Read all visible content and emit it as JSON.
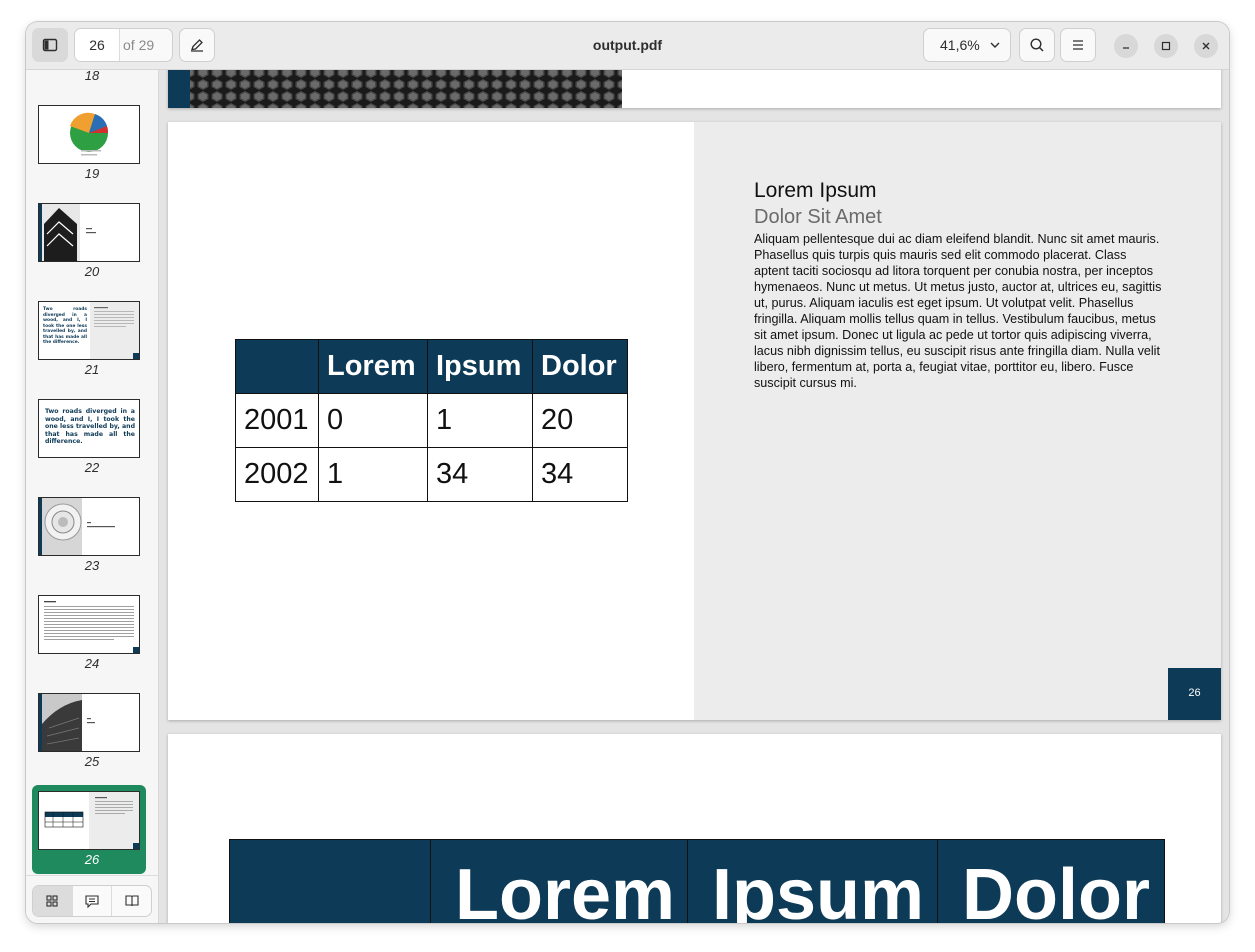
{
  "header": {
    "current_page": "26",
    "of_pages": "of 29",
    "doc_title": "output.pdf",
    "zoom": "41,6%"
  },
  "sidebar": {
    "thumbnails": [
      {
        "page": "18"
      },
      {
        "page": "19"
      },
      {
        "page": "20"
      },
      {
        "page": "21"
      },
      {
        "page": "22"
      },
      {
        "page": "23"
      },
      {
        "page": "24"
      },
      {
        "page": "25"
      },
      {
        "page": "26",
        "selected": true
      }
    ],
    "thumb22_quote": "Two roads diverged in a wood, and I, I took the one less travelled by, and that has made all the difference.",
    "thumb21_quote": "Two roads diverged in a wood, and I, I took the one less travelled by, and that has made all the difference.",
    "selected_color": "#1e8a5e"
  },
  "document": {
    "accent_color": "#0d3a57",
    "page26": {
      "title": "Lorem Ipsum",
      "subtitle": "Dolor Sit Amet",
      "body": "Aliquam pellentesque dui ac diam eleifend blandit. Nunc sit amet mauris. Phasellus quis turpis quis mauris sed elit commodo placerat. Class aptent taciti sociosqu ad litora torquent per conubia nostra, per inceptos hymenaeos. Nunc ut metus. Ut metus justo, auctor at, ultrices eu, sagittis ut, purus. Aliquam iaculis est eget ipsum. Ut volutpat velit. Phasellus fringilla. Aliquam mollis tellus quam in tellus. Vestibulum faucibus, metus sit amet ipsum. Donec ut ligula ac pede ut tortor quis adipiscing viverra, lacus nibh dignissim tellus, eu suscipit risus ante fringilla diam. Nulla velit libero, fermentum at, porta a, feugiat vitae, porttitor eu, libero. Fusce suscipit cursus mi.",
      "page_number": "26",
      "table": {
        "headers": [
          "",
          "Lorem",
          "Ipsum",
          "Dolor"
        ],
        "rows": [
          [
            "2001",
            "0",
            "1",
            "20"
          ],
          [
            "2002",
            "1",
            "34",
            "34"
          ]
        ]
      }
    },
    "page27_table_headers": [
      "",
      "Lorem",
      "Ipsum",
      "Dolor"
    ]
  }
}
